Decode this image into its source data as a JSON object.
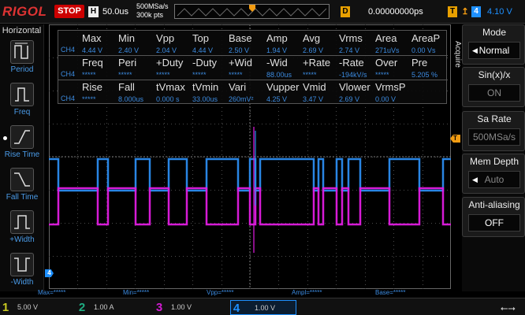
{
  "brand": "RIGOL",
  "top": {
    "run_state": "STOP",
    "horiz_badge": "H",
    "timebase": "50.0us",
    "sample_rate": "500MSa/s",
    "mem_points": "300k pts",
    "delay_badge": "D",
    "trigger_delay": "0.00000000ps",
    "trigger_badge": "T",
    "trigger_source": "4",
    "trigger_level": "4.10 V"
  },
  "left_panel": {
    "title": "Horizontal",
    "buttons": [
      "Period",
      "Freq",
      "Rise Time",
      "Fall Time",
      "+Width",
      "-Width"
    ]
  },
  "measurements": {
    "row1": {
      "headers": [
        "Max",
        "Min",
        "Vpp",
        "Top",
        "Base",
        "Amp",
        "Avg",
        "Vrms",
        "Area",
        "AreaP"
      ],
      "channel": "CH4",
      "values": [
        "4.44 V",
        "2.40 V",
        "2.04 V",
        "4.44 V",
        "2.50 V",
        "1.94 V",
        "2.69 V",
        "2.74 V",
        "271uVs",
        "0.00 Vs"
      ]
    },
    "row2": {
      "headers": [
        "Freq",
        "Peri",
        "+Duty",
        "-Duty",
        "+Wid",
        "-Wid",
        "+Rate",
        "-Rate",
        "Over",
        "Pre"
      ],
      "channel": "CH4",
      "values": [
        "*****",
        "*****",
        "*****",
        "*****",
        "*****",
        "88.00us",
        "*****",
        "-194kV/s",
        "*****",
        "5.205 %"
      ]
    },
    "row3": {
      "headers": [
        "Rise",
        "Fall",
        "tVmax",
        "tVmin",
        "Vari",
        "Vupper",
        "Vmid",
        "Vlower",
        "VrmsP"
      ],
      "channel": "CH4",
      "values": [
        "*****",
        "8.000us",
        "0.000 s",
        "33.00us",
        "260mV²",
        "4.25 V",
        "3.47 V",
        "2.69 V",
        "0.00 V"
      ]
    }
  },
  "right_menu": {
    "section": "Acquire",
    "items": [
      {
        "title": "Mode",
        "value": "Normal"
      },
      {
        "title": "Sin(x)/x",
        "value": "ON"
      },
      {
        "title": "Sa Rate",
        "value": "500MSa/s"
      },
      {
        "title": "Mem Depth",
        "value": "Auto"
      },
      {
        "title": "Anti-aliasing",
        "value": "OFF"
      }
    ]
  },
  "bottom_readouts": [
    "Max=*****",
    "Min=*****",
    "Vpp=*****",
    "Ampl=*****",
    "Base=*****"
  ],
  "channels": [
    {
      "num": "1",
      "value": "5.00 V",
      "color": "#c9c921"
    },
    {
      "num": "2",
      "value": "1.00 A",
      "color": "#1fae83"
    },
    {
      "num": "3",
      "value": "1.00 V",
      "color": "#d21bd2"
    },
    {
      "num": "4",
      "value": "1.00 V",
      "color": "#1e90ff"
    }
  ],
  "markers": {
    "trigger_level_label": "T",
    "channel4_ref_label": "4"
  },
  "colors": {
    "ch4_trace": "#2b8cf0",
    "ch3_trace": "#e21ce2",
    "grid": "#4a4a4a",
    "accent": "#f39c12",
    "stop_red": "#cc0000"
  }
}
